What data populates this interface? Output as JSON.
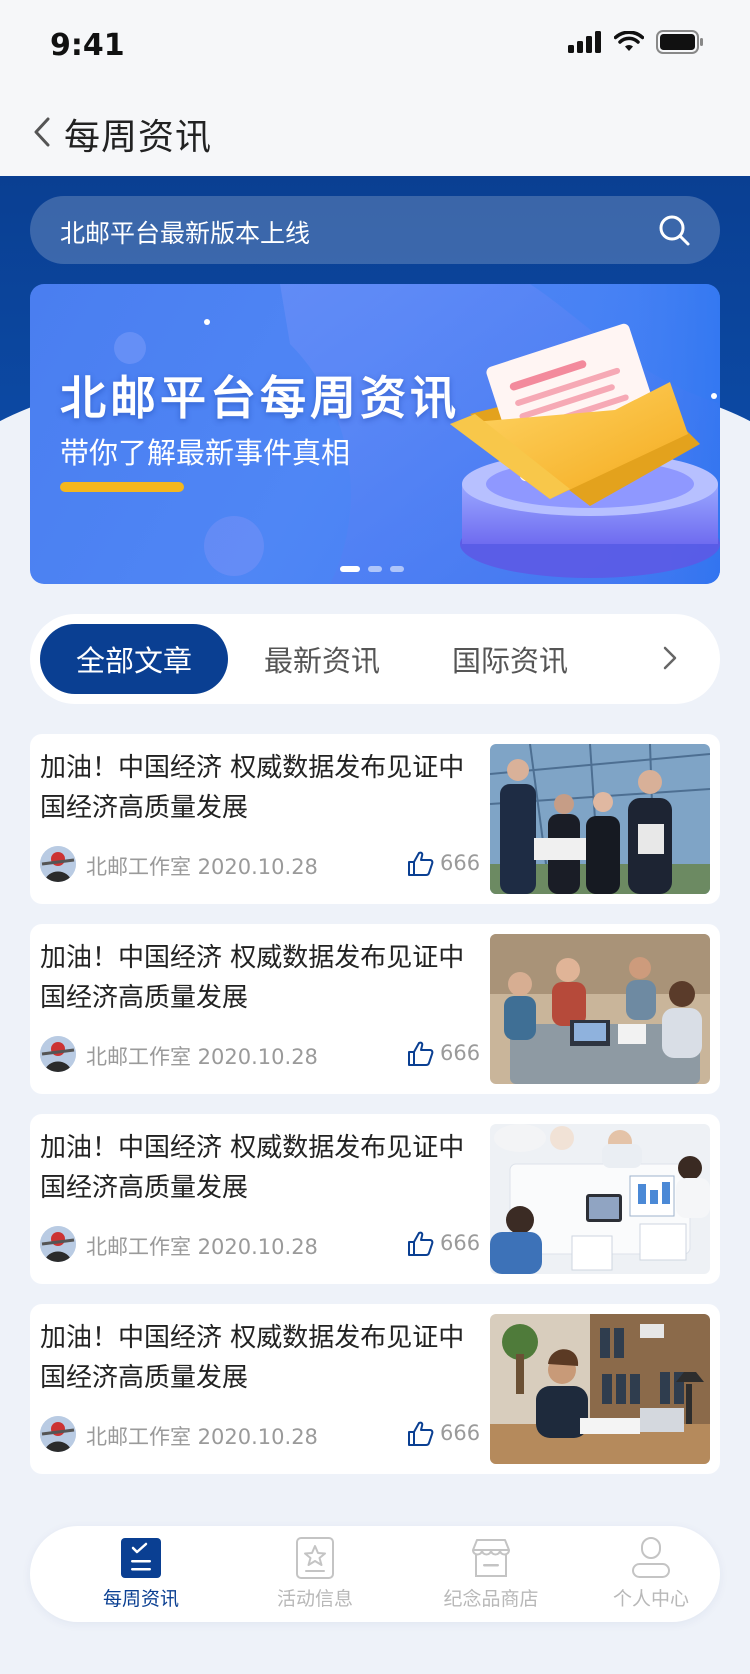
{
  "status_bar": {
    "time": "9:41"
  },
  "nav": {
    "title": "每周资讯"
  },
  "search": {
    "text": "北邮平台最新版本上线"
  },
  "banner": {
    "title": "北邮平台每周资讯",
    "subtitle": "带你了解最新事件真相",
    "slide_count": 3,
    "active_slide": 1
  },
  "tabs": [
    {
      "label": "全部文章",
      "active": true
    },
    {
      "label": "最新资讯",
      "active": false
    },
    {
      "label": "国际资讯",
      "active": false
    }
  ],
  "articles": [
    {
      "title": "加油！中国经济 权威数据发布见证中国经济高质量发展",
      "author": "北邮工作室 2020.10.28",
      "likes": "666"
    },
    {
      "title": "加油！中国经济 权威数据发布见证中国经济高质量发展",
      "author": "北邮工作室 2020.10.28",
      "likes": "666"
    },
    {
      "title": "加油！中国经济 权威数据发布见证中国经济高质量发展",
      "author": "北邮工作室 2020.10.28",
      "likes": "666"
    },
    {
      "title": "加油！中国经济 权威数据发布见证中国经济高质量发展",
      "author": "北邮工作室 2020.10.28",
      "likes": "666"
    }
  ],
  "tab_bar": [
    {
      "label": "每周资讯",
      "icon": "checklist-icon",
      "active": true
    },
    {
      "label": "活动信息",
      "icon": "star-card-icon",
      "active": false
    },
    {
      "label": "纪念品商店",
      "icon": "store-icon",
      "active": false
    },
    {
      "label": "个人中心",
      "icon": "person-icon",
      "active": false
    }
  ],
  "colors": {
    "primary": "#0a3f92",
    "banner_blue": "#4a7ef0",
    "accent_yellow": "#f5b71d",
    "background": "#eef2f9"
  }
}
